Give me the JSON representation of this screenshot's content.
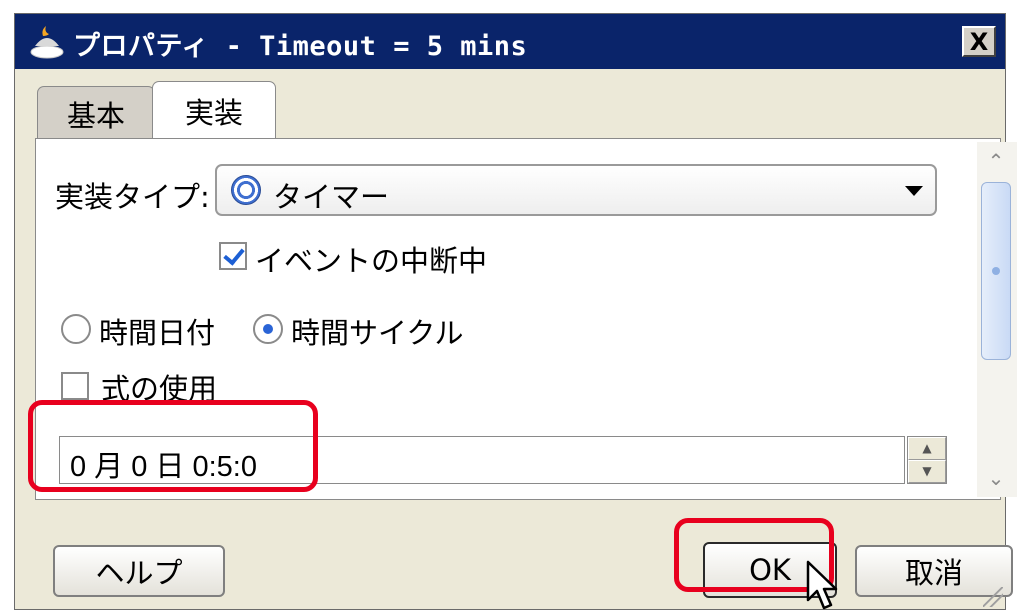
{
  "window": {
    "title": "プロパティ - Timeout = 5 mins",
    "close_label": "X"
  },
  "tabs": [
    {
      "label": "基本",
      "active": false
    },
    {
      "label": "実装",
      "active": true
    }
  ],
  "form": {
    "impl_type_label": "実装タイプ:",
    "impl_type_value": "タイマー",
    "interrupt_checkbox_label": "イベントの中断中",
    "interrupt_checked": true,
    "radio_date_label": "時間日付",
    "radio_cycle_label": "時間サイクル",
    "selected_radio": "時間サイクル",
    "use_expression_label": "式の使用",
    "use_expression_checked": false,
    "duration_value": "0 月 0 日 0:5:0"
  },
  "buttons": {
    "help": "ヘルプ",
    "ok": "OK",
    "cancel": "取消"
  },
  "colors": {
    "titlebar": "#0a246a",
    "highlight": "#e8001e",
    "dialog_bg": "#ece9d8"
  },
  "icons": [
    "app-icon",
    "clock-icon",
    "chevron-down-icon",
    "close-icon",
    "cursor-pointer-icon"
  ]
}
